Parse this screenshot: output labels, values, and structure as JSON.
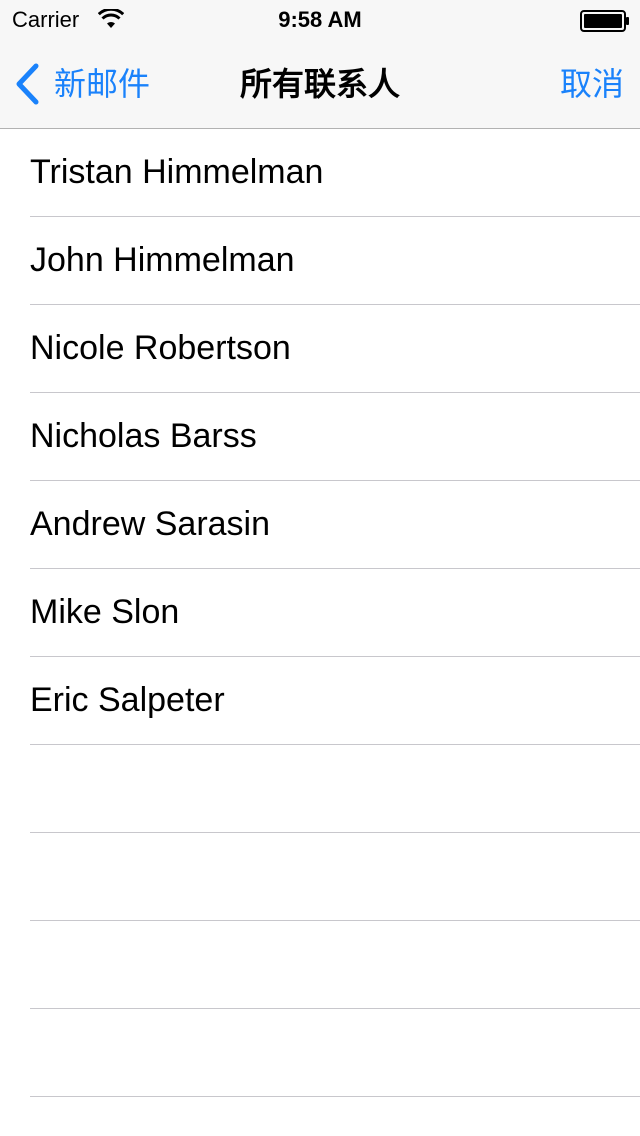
{
  "status_bar": {
    "carrier": "Carrier",
    "time": "9:58 AM"
  },
  "nav": {
    "back_label": "新邮件",
    "title": "所有联系人",
    "cancel_label": "取消",
    "accent_color": "#1a82fb"
  },
  "contacts": [
    "Tristan Himmelman",
    "John Himmelman",
    "Nicole Robertson",
    "Nicholas Barss",
    "Andrew Sarasin",
    "Mike Slon",
    "Eric Salpeter"
  ],
  "icons": {
    "wifi": "wifi-icon",
    "battery": "battery-icon",
    "back": "chevron-left-icon"
  }
}
